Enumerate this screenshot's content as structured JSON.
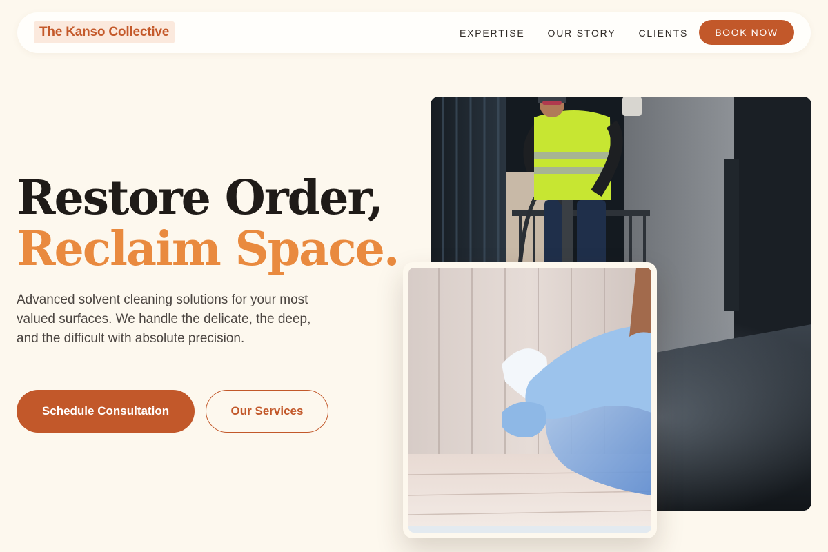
{
  "nav": {
    "brand": "The Kanso Collective",
    "links": [
      "EXPERTISE",
      "OUR STORY",
      "CLIENTS"
    ],
    "cta": "BOOK NOW"
  },
  "hero": {
    "headline_line1": "Restore Order,",
    "headline_line2": "Reclaim Space.",
    "description": "Advanced solvent cleaning solutions for your most valued surfaces. We handle the delicate, the deep, and the difficult with absolute precision.",
    "primary_button": "Schedule Consultation",
    "secondary_button": "Our Services"
  },
  "colors": {
    "background": "#fdf8ee",
    "accent": "#c2582a",
    "headline_accent": "#e98a3f",
    "headline_dark": "#1f1b18"
  }
}
